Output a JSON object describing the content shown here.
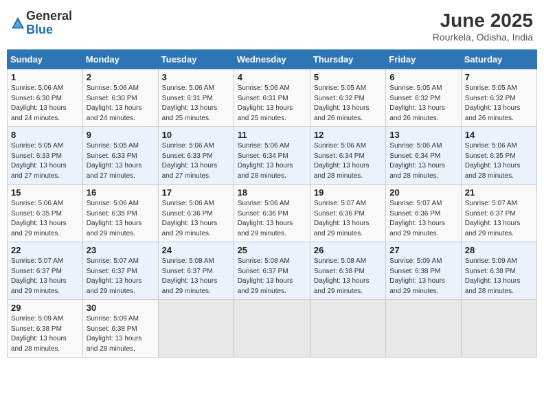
{
  "header": {
    "logo_general": "General",
    "logo_blue": "Blue",
    "month": "June 2025",
    "location": "Rourkela, Odisha, India"
  },
  "weekdays": [
    "Sunday",
    "Monday",
    "Tuesday",
    "Wednesday",
    "Thursday",
    "Friday",
    "Saturday"
  ],
  "weeks": [
    [
      {
        "day": "1",
        "info": "Sunrise: 5:06 AM\nSunset: 6:30 PM\nDaylight: 13 hours\nand 24 minutes."
      },
      {
        "day": "2",
        "info": "Sunrise: 5:06 AM\nSunset: 6:30 PM\nDaylight: 13 hours\nand 24 minutes."
      },
      {
        "day": "3",
        "info": "Sunrise: 5:06 AM\nSunset: 6:31 PM\nDaylight: 13 hours\nand 25 minutes."
      },
      {
        "day": "4",
        "info": "Sunrise: 5:06 AM\nSunset: 6:31 PM\nDaylight: 13 hours\nand 25 minutes."
      },
      {
        "day": "5",
        "info": "Sunrise: 5:05 AM\nSunset: 6:32 PM\nDaylight: 13 hours\nand 26 minutes."
      },
      {
        "day": "6",
        "info": "Sunrise: 5:05 AM\nSunset: 6:32 PM\nDaylight: 13 hours\nand 26 minutes."
      },
      {
        "day": "7",
        "info": "Sunrise: 5:05 AM\nSunset: 6:32 PM\nDaylight: 13 hours\nand 26 minutes."
      }
    ],
    [
      {
        "day": "8",
        "info": "Sunrise: 5:05 AM\nSunset: 6:33 PM\nDaylight: 13 hours\nand 27 minutes."
      },
      {
        "day": "9",
        "info": "Sunrise: 5:05 AM\nSunset: 6:33 PM\nDaylight: 13 hours\nand 27 minutes."
      },
      {
        "day": "10",
        "info": "Sunrise: 5:06 AM\nSunset: 6:33 PM\nDaylight: 13 hours\nand 27 minutes."
      },
      {
        "day": "11",
        "info": "Sunrise: 5:06 AM\nSunset: 6:34 PM\nDaylight: 13 hours\nand 28 minutes."
      },
      {
        "day": "12",
        "info": "Sunrise: 5:06 AM\nSunset: 6:34 PM\nDaylight: 13 hours\nand 28 minutes."
      },
      {
        "day": "13",
        "info": "Sunrise: 5:06 AM\nSunset: 6:34 PM\nDaylight: 13 hours\nand 28 minutes."
      },
      {
        "day": "14",
        "info": "Sunrise: 5:06 AM\nSunset: 6:35 PM\nDaylight: 13 hours\nand 28 minutes."
      }
    ],
    [
      {
        "day": "15",
        "info": "Sunrise: 5:06 AM\nSunset: 6:35 PM\nDaylight: 13 hours\nand 29 minutes."
      },
      {
        "day": "16",
        "info": "Sunrise: 5:06 AM\nSunset: 6:35 PM\nDaylight: 13 hours\nand 29 minutes."
      },
      {
        "day": "17",
        "info": "Sunrise: 5:06 AM\nSunset: 6:36 PM\nDaylight: 13 hours\nand 29 minutes."
      },
      {
        "day": "18",
        "info": "Sunrise: 5:06 AM\nSunset: 6:36 PM\nDaylight: 13 hours\nand 29 minutes."
      },
      {
        "day": "19",
        "info": "Sunrise: 5:07 AM\nSunset: 6:36 PM\nDaylight: 13 hours\nand 29 minutes."
      },
      {
        "day": "20",
        "info": "Sunrise: 5:07 AM\nSunset: 6:36 PM\nDaylight: 13 hours\nand 29 minutes."
      },
      {
        "day": "21",
        "info": "Sunrise: 5:07 AM\nSunset: 6:37 PM\nDaylight: 13 hours\nand 29 minutes."
      }
    ],
    [
      {
        "day": "22",
        "info": "Sunrise: 5:07 AM\nSunset: 6:37 PM\nDaylight: 13 hours\nand 29 minutes."
      },
      {
        "day": "23",
        "info": "Sunrise: 5:07 AM\nSunset: 6:37 PM\nDaylight: 13 hours\nand 29 minutes."
      },
      {
        "day": "24",
        "info": "Sunrise: 5:08 AM\nSunset: 6:37 PM\nDaylight: 13 hours\nand 29 minutes."
      },
      {
        "day": "25",
        "info": "Sunrise: 5:08 AM\nSunset: 6:37 PM\nDaylight: 13 hours\nand 29 minutes."
      },
      {
        "day": "26",
        "info": "Sunrise: 5:08 AM\nSunset: 6:38 PM\nDaylight: 13 hours\nand 29 minutes."
      },
      {
        "day": "27",
        "info": "Sunrise: 5:09 AM\nSunset: 6:38 PM\nDaylight: 13 hours\nand 29 minutes."
      },
      {
        "day": "28",
        "info": "Sunrise: 5:09 AM\nSunset: 6:38 PM\nDaylight: 13 hours\nand 28 minutes."
      }
    ],
    [
      {
        "day": "29",
        "info": "Sunrise: 5:09 AM\nSunset: 6:38 PM\nDaylight: 13 hours\nand 28 minutes."
      },
      {
        "day": "30",
        "info": "Sunrise: 5:09 AM\nSunset: 6:38 PM\nDaylight: 13 hours\nand 28 minutes."
      },
      {
        "day": "",
        "info": ""
      },
      {
        "day": "",
        "info": ""
      },
      {
        "day": "",
        "info": ""
      },
      {
        "day": "",
        "info": ""
      },
      {
        "day": "",
        "info": ""
      }
    ]
  ]
}
